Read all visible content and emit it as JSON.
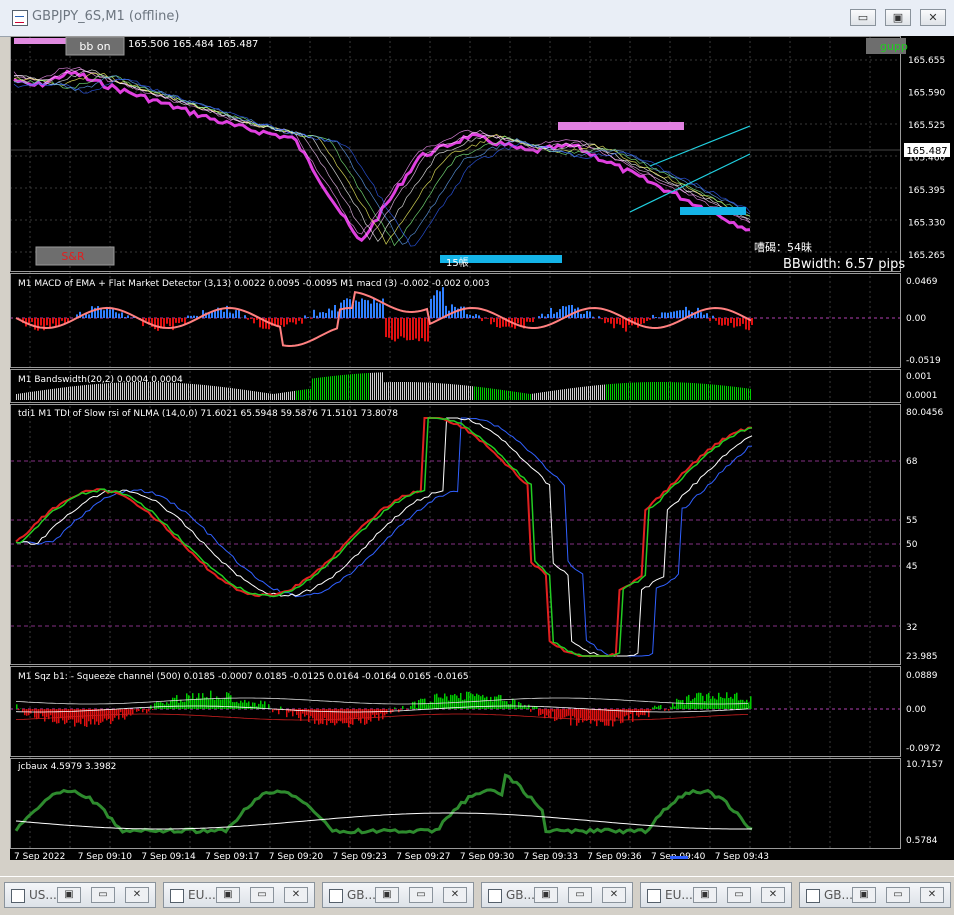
{
  "window": {
    "title": "GBPJPY_6S,M1 (offline)",
    "buttons": {
      "minimize": "▭",
      "restore": "▣",
      "close": "✕"
    }
  },
  "main_chart": {
    "bb_button": "bb on",
    "ohlc": "165.506 165.484 165.487",
    "gupp_label": "gupp",
    "snr_button": "S&R",
    "price_tag": "165.487",
    "lots_label": "15帳",
    "alert_text": "嘈碣：54昧",
    "bbwidth_text": "BBwidth: 6.57 pips",
    "price_axis": [
      "165.655",
      "165.590",
      "165.525",
      "165.460",
      "165.395",
      "165.330",
      "165.265"
    ]
  },
  "panels": {
    "macd": {
      "label": "M1 MACD of EMA + Flat Market Detector (3,13) 0.0022 0.0095 -0.0095  M1  macd (3) -0.002 -0.002 0.003",
      "axis": [
        "0.0469",
        "0.00",
        "-0.0519"
      ]
    },
    "bandwidth": {
      "label": "M1 Bandswidth(20,2) 0.0004 0.0004",
      "axis": [
        "0.001",
        "0.0001"
      ]
    },
    "tdi": {
      "label": "tdi1 M1 TDI of Slow rsi of NLMA (14,0,0) 71.6021 65.5948 59.5876 71.5101 73.8078",
      "axis": [
        "80.0456",
        "68",
        "55",
        "50",
        "45",
        "32",
        "23.985"
      ]
    },
    "sqz": {
      "label": "M1 Sqz b1: - Squeeze channel (500) 0.0185 -0.0007 0.0185 -0.0125 0.0164 -0.0164 0.0165 -0.0165",
      "axis": [
        "0.0889",
        "0.00",
        "-0.0972"
      ]
    },
    "jcbaux": {
      "label": "jcbaux  4.5979 3.3982",
      "axis": [
        "10.7157",
        "0.5784"
      ]
    }
  },
  "time_axis": [
    "7 Sep 2022",
    "7 Sep 09:10",
    "7 Sep 09:14",
    "7 Sep 09:17",
    "7 Sep 09:20",
    "7 Sep 09:23",
    "7 Sep 09:27",
    "7 Sep 09:30",
    "7 Sep 09:33",
    "7 Sep 09:36",
    "7 Sep 09:40",
    "7 Sep 09:43"
  ],
  "tabs": [
    {
      "label": "US..."
    },
    {
      "label": "EU..."
    },
    {
      "label": "GB..."
    },
    {
      "label": "GB..."
    },
    {
      "label": "EU..."
    },
    {
      "label": "GB..."
    }
  ],
  "colors": {
    "background": "#000000",
    "grid": "#4a4a4a",
    "magenta": "#e040e0",
    "cyan": "#14b4e8",
    "green": "#00cc00",
    "red": "#e01010",
    "blue": "#3060ff",
    "axis_text": "#ffffff"
  },
  "icons": [
    "chart-window-icon",
    "minimize-icon",
    "restore-icon",
    "close-icon"
  ]
}
